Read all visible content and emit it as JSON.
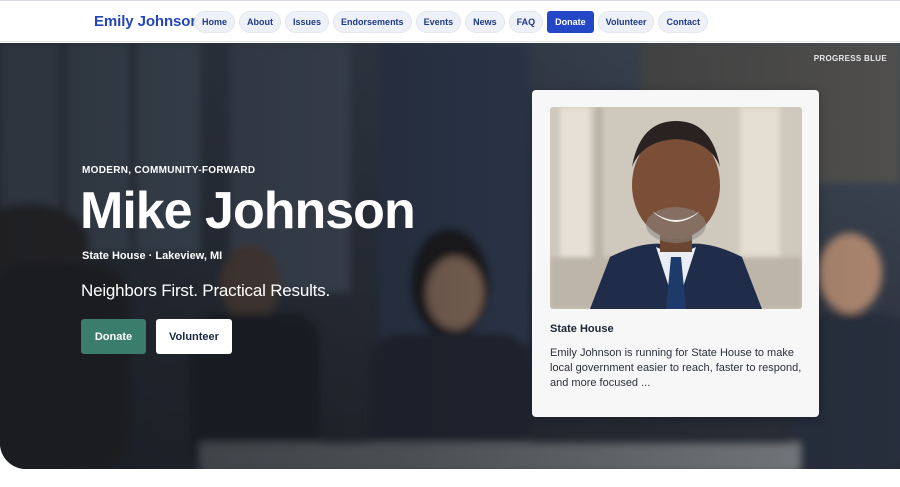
{
  "nav": {
    "brand": "Emily Johnson",
    "links": [
      {
        "label": "Home"
      },
      {
        "label": "About"
      },
      {
        "label": "Issues"
      },
      {
        "label": "Endorsements"
      },
      {
        "label": "Events"
      },
      {
        "label": "News"
      },
      {
        "label": "FAQ"
      },
      {
        "label": "Donate"
      },
      {
        "label": "Volunteer"
      },
      {
        "label": "Contact"
      }
    ]
  },
  "hero": {
    "theme_tag": "PROGRESS BLUE",
    "eyebrow": "MODERN, COMMUNITY-FORWARD",
    "name": "Mike Johnson",
    "district": "State House · Lakeview, MI",
    "slogan": "Neighbors First. Practical Results.",
    "donate_label": "Donate",
    "volunteer_label": "Volunteer"
  },
  "card": {
    "title": "State House",
    "text": "Emily Johnson is running for State House to make local government easier to reach, faster to respond, and more focused ..."
  },
  "colors": {
    "brand": "#2447b8",
    "accent_active": "#2447c7",
    "donate_button": "#3a7d6c"
  }
}
